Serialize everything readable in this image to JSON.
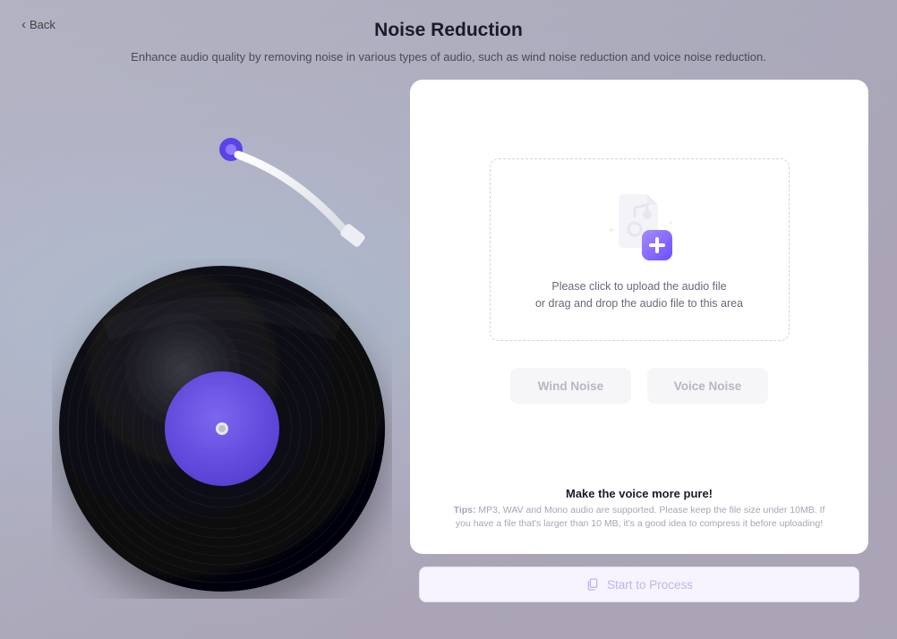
{
  "nav": {
    "back_label": "Back"
  },
  "header": {
    "title": "Noise Reduction",
    "subtitle": "Enhance audio quality by removing noise in various types of audio, such as wind noise reduction and voice noise reduction."
  },
  "upload": {
    "line1": "Please click to upload the audio file",
    "line2": "or drag and drop the audio file to this area"
  },
  "options": {
    "wind": "Wind Noise",
    "voice": "Voice Noise"
  },
  "tips": {
    "headline": "Make the voice more pure!",
    "prefix": "Tips:",
    "body": " MP3, WAV and Mono audio are supported. Please keep the file size under 10MB. If you have a file that's larger than 10 MB, it's a good idea to compress it before uploading!"
  },
  "action": {
    "process_label": "Start to Process"
  },
  "colors": {
    "accent": "#7c5cff"
  }
}
